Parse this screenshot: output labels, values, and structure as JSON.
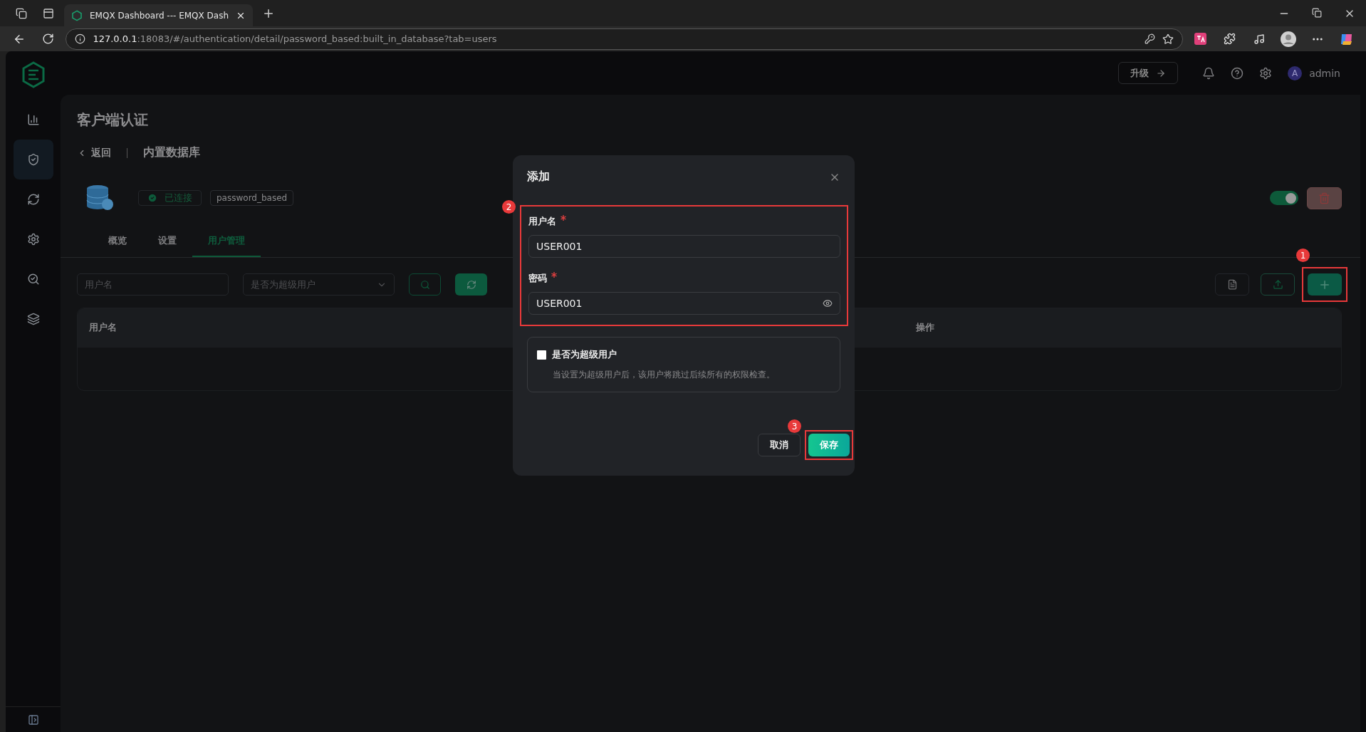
{
  "browser": {
    "tab_title": "EMQX Dashboard --- EMQX Dash",
    "url_host": "127.0.0.1",
    "url_rest": ":18083/#/authentication/detail/password_based:built_in_database?tab=users"
  },
  "header": {
    "upgrade": "升级",
    "user_initial": "A",
    "user": "admin"
  },
  "sidebar": {
    "items": [
      {
        "kind": "dashboard",
        "selected": false
      },
      {
        "kind": "access",
        "selected": true
      },
      {
        "kind": "integration",
        "selected": false
      },
      {
        "kind": "management",
        "selected": false
      },
      {
        "kind": "diagnose",
        "selected": false
      },
      {
        "kind": "extensions",
        "selected": false
      }
    ]
  },
  "page": {
    "title": "客户端认证",
    "back": "返回",
    "name": "内置数据库",
    "status": "已连接",
    "tag": "password_based",
    "enabled": true,
    "tabs": [
      {
        "label": "概览",
        "selected": false
      },
      {
        "label": "设置",
        "selected": false
      },
      {
        "label": "用户管理",
        "selected": true
      }
    ]
  },
  "filters": {
    "username_placeholder": "用户名",
    "superuser_placeholder": "是否为超级用户"
  },
  "table": {
    "columns": [
      "用户名",
      "操作"
    ]
  },
  "dialog": {
    "title": "添加",
    "fields": [
      {
        "kind": "text",
        "label": "用户名",
        "required": true,
        "value": "USER001"
      },
      {
        "kind": "password",
        "label": "密码",
        "required": true,
        "value": "USER001"
      }
    ],
    "superuser": {
      "label": "是否为超级用户",
      "checked": false,
      "hint": "当设置为超级用户后，该用户将跳过后续所有的权限检查。"
    },
    "cancel": "取消",
    "save": "保存"
  },
  "annotations": [
    "1",
    "2",
    "3"
  ]
}
